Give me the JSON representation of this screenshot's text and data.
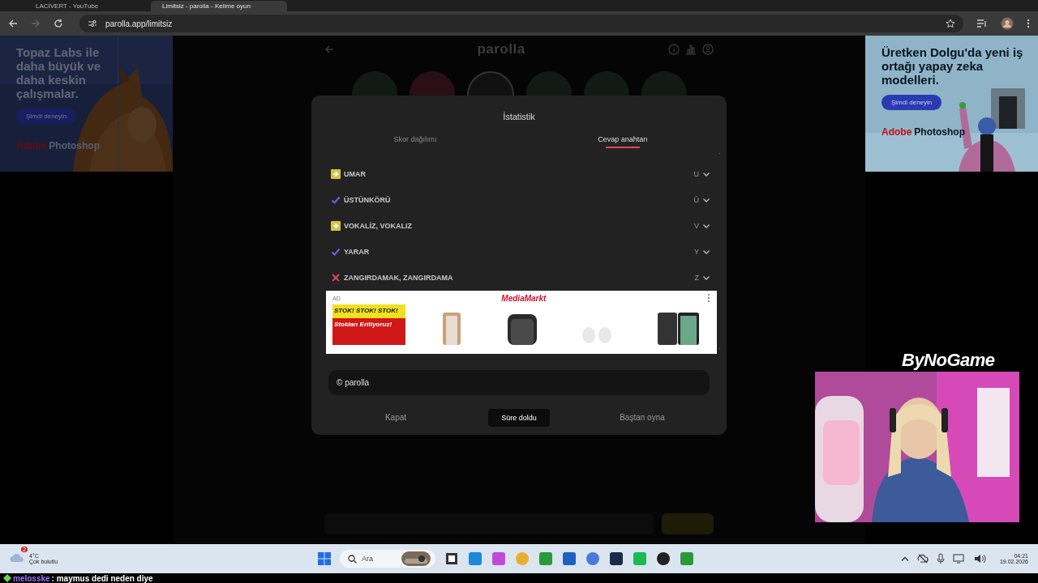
{
  "browser": {
    "tabs": [
      {
        "title": "LACİVERT - YouTube",
        "selected": false
      },
      {
        "title": "Limitsiz - parolla - Kelime oyun",
        "selected": true
      }
    ],
    "url": "parolla.app/limitsiz"
  },
  "ads": [
    {
      "headline": "Topaz Labs ile daha büyük ve daha keskin çalışmalar.",
      "button": "Şimdi deneyin",
      "brand": "Adobe",
      "product": "Photoshop"
    },
    {
      "headline": "Üretken Dolgu'da yeni iş ortağı yapay zeka modelleri.",
      "button": "Şimdi deneyin",
      "brand": "Adobe",
      "product": "Photoshop"
    }
  ],
  "site": {
    "logo": "parolla"
  },
  "modal": {
    "title": "İstatistik",
    "tabs": [
      {
        "label": "Skor dağılımı",
        "selected": false
      },
      {
        "label": "Cevap anahtarı",
        "selected": true
      }
    ],
    "answers": [
      {
        "kind": "pass",
        "word": "UMAR",
        "letter": "U",
        "expanded": false
      },
      {
        "kind": "correct",
        "word": "ÜSTÜNKÖRÜ",
        "letter": "Ü",
        "expanded": false
      },
      {
        "kind": "pass",
        "word": "VOKALİZ, VOKALIZ",
        "letter": "V",
        "expanded": false
      },
      {
        "kind": "correct",
        "word": "YARAR",
        "letter": "Y",
        "expanded": false
      },
      {
        "kind": "wrong",
        "word": "ZANGIRDAMAK, ZANGIRDAMA",
        "letter": "Z",
        "expanded": false
      }
    ],
    "ad": {
      "label": "AD",
      "brand": "MediaMarkt",
      "promo": "STOK! STOK! STOK!",
      "subline": "Stokları Eritiyoruz!"
    },
    "footer": "© parolla",
    "buttons": [
      {
        "label": "Kapat",
        "selected": false
      },
      {
        "label": "Süre doldu",
        "selected": true
      },
      {
        "label": "Baştan oyna",
        "selected": false
      }
    ]
  },
  "overlay": {
    "logo": "ByNoGame"
  },
  "taskbar": {
    "weather": {
      "temp": "4°C",
      "desc": "Çok bulutlu",
      "badge": "2"
    },
    "search": "Ara",
    "time": "04:21",
    "date": "19.02.2026"
  },
  "chat": {
    "user": "melosske",
    "message": ": maymus dedi neden diye"
  }
}
